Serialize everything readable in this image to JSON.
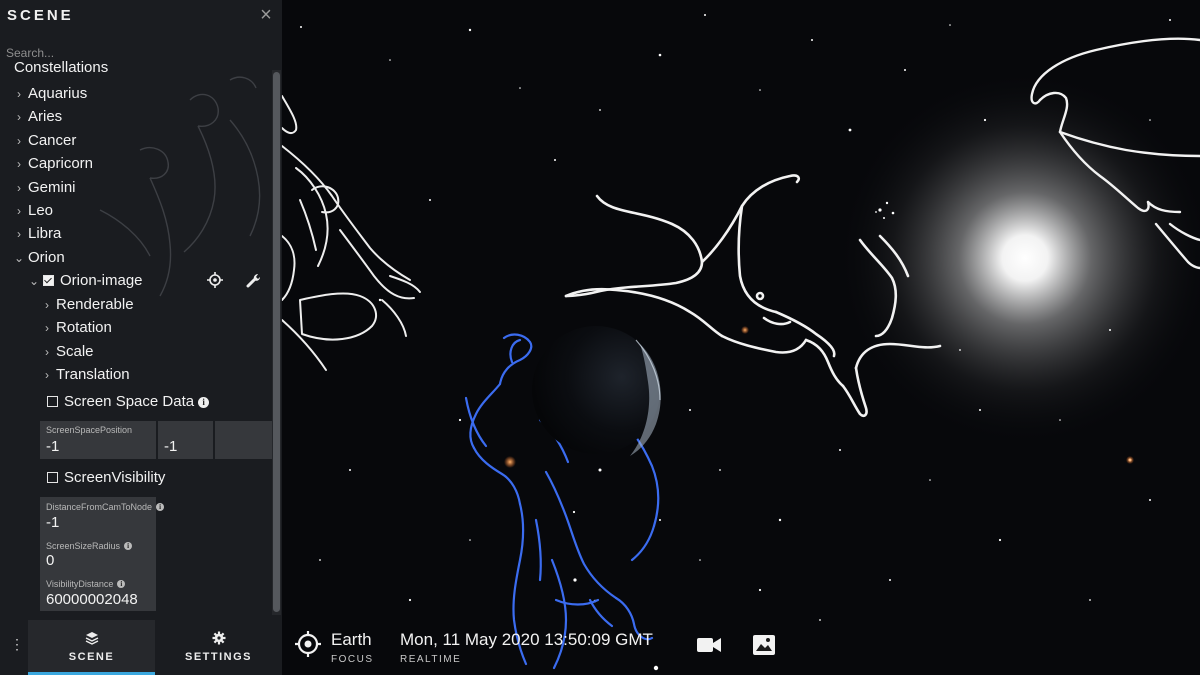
{
  "panel": {
    "title": "SCENE",
    "close_icon": "close-icon",
    "search_placeholder": "Search...",
    "tree": {
      "group_label": "Constellations",
      "items": [
        "Aquarius",
        "Aries",
        "Cancer",
        "Capricorn",
        "Gemini",
        "Leo",
        "Libra",
        "Orion"
      ],
      "expanded_item": "Orion",
      "node": {
        "label": "Orion-image",
        "checked": true,
        "focus_icon": "target-icon",
        "settings_icon": "wrench-icon"
      },
      "node_children": [
        "Renderable",
        "Rotation",
        "Scale",
        "Translation"
      ],
      "screen_space": {
        "label": "Screen Space Data",
        "checked": false,
        "position_label": "ScreenSpacePosition",
        "position_x": "-1",
        "position_y": "-1"
      },
      "screen_visibility": {
        "label": "ScreenVisibility",
        "checked": false,
        "distance_label": "DistanceFromCamToNode",
        "distance_value": "-1",
        "radius_label": "ScreenSizeRadius",
        "radius_value": "0",
        "visibility_label": "VisibilityDistance",
        "visibility_value": "60000002048"
      }
    }
  },
  "bottom_bar": {
    "menu_icon": "vertical-dots-icon",
    "tabs": [
      {
        "label": "SCENE",
        "icon": "layers-icon",
        "active": true
      },
      {
        "label": "SETTINGS",
        "icon": "gear-icon",
        "active": false
      }
    ],
    "focus": {
      "name": "Earth",
      "sub": "FOCUS",
      "icon": "crosshair-icon"
    },
    "time": {
      "value": "Mon, 11 May 2020 13:50:09 GMT",
      "sub": "REALTIME"
    },
    "camera_icon": "video-camera-icon",
    "image_icon": "image-icon"
  },
  "colors": {
    "panel_bg": "#1c1e22",
    "accent": "#3aa7de",
    "orion_lines": "#3b6cf0",
    "constellation_lines": "#f2f2f2",
    "sky": "#07080b"
  }
}
